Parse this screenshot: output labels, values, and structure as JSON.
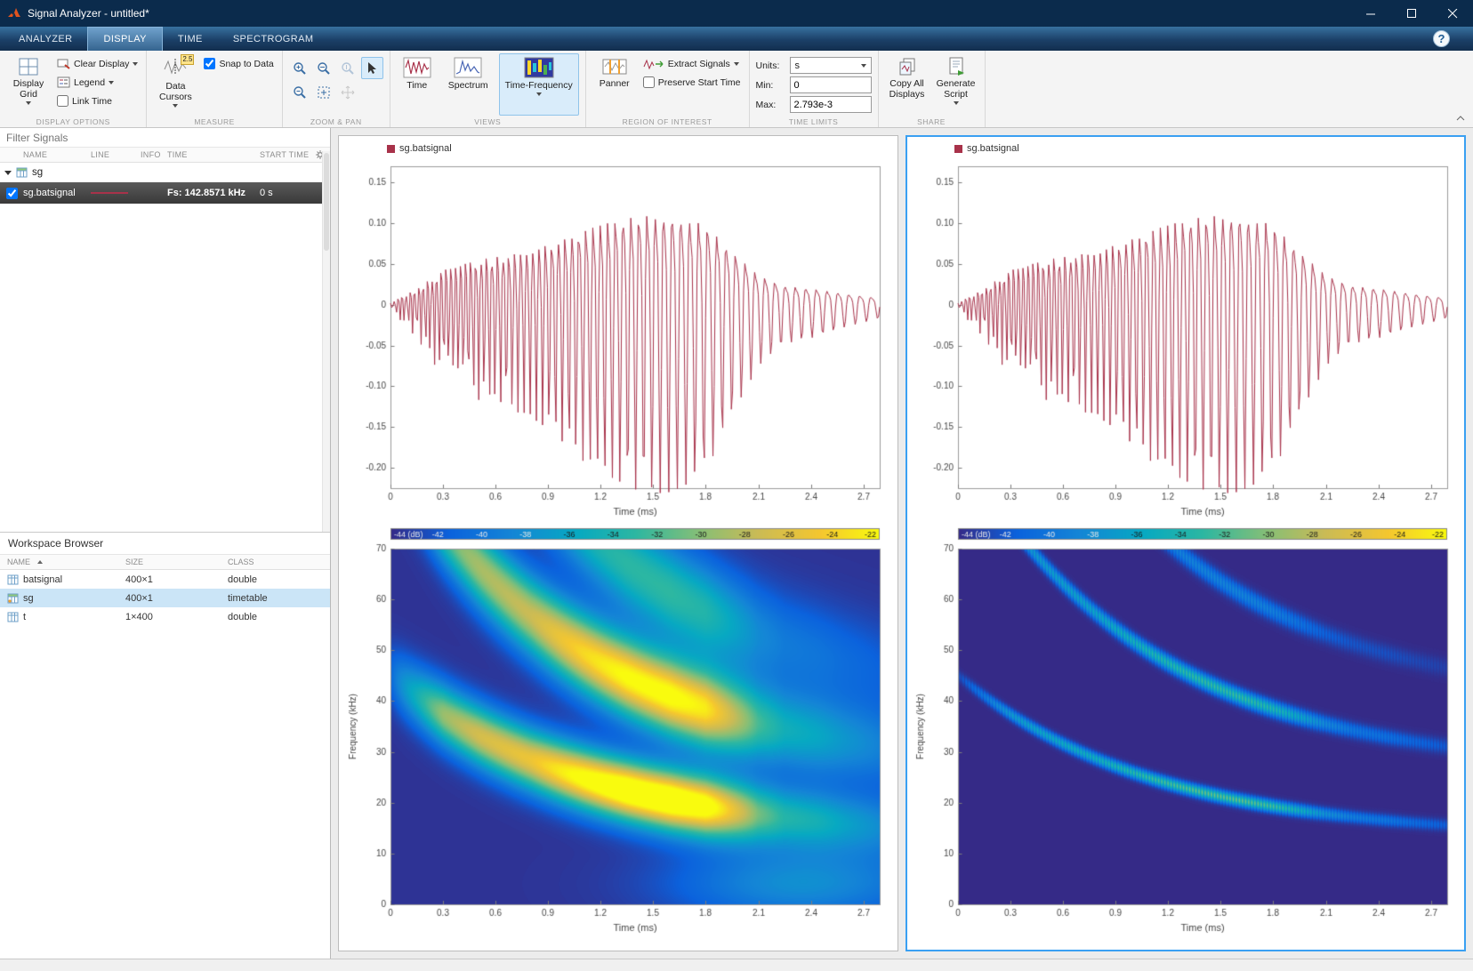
{
  "window": {
    "title": "Signal Analyzer - untitled*",
    "help": "?"
  },
  "tabs": [
    {
      "label": "ANALYZER"
    },
    {
      "label": "DISPLAY"
    },
    {
      "label": "TIME"
    },
    {
      "label": "SPECTROGRAM"
    }
  ],
  "ribbon": {
    "sections": {
      "display_options": {
        "label": "DISPLAY OPTIONS",
        "grid": "Display Grid",
        "clear": "Clear Display",
        "legend": "Legend",
        "link": "Link Time"
      },
      "measure": {
        "label": "MEASURE",
        "cursors": "Data Cursors",
        "badge": "2.5",
        "snap": "Snap to Data"
      },
      "zoom": {
        "label": "ZOOM & PAN"
      },
      "views": {
        "label": "VIEWS",
        "time": "Time",
        "spectrum": "Spectrum",
        "tf": "Time-Frequency"
      },
      "roi": {
        "label": "REGION OF INTEREST",
        "panner": "Panner",
        "extract": "Extract Signals",
        "preserve": "Preserve Start Time"
      },
      "limits": {
        "label": "TIME LIMITS",
        "units": "Units:",
        "units_value": "s",
        "min": "Min:",
        "min_value": "0",
        "max": "Max:",
        "max_value": "2.793e-3"
      },
      "share": {
        "label": "SHARE",
        "copy": "Copy All Displays",
        "script": "Generate Script"
      }
    }
  },
  "signals": {
    "filter_placeholder": "Filter Signals",
    "headers": {
      "name": "NAME",
      "line": "LINE",
      "info": "INFO",
      "time": "TIME",
      "start": "START TIME"
    },
    "group_label": "sg",
    "row": {
      "name": "sg.batsignal",
      "time": "Fs: 142.8571 kHz",
      "start": "0 s"
    }
  },
  "workspace": {
    "title": "Workspace Browser",
    "headers": {
      "name": "NAME",
      "size": "SIZE",
      "class": "CLASS"
    },
    "rows": [
      {
        "name": "batsignal",
        "size": "400×1",
        "class": "double"
      },
      {
        "name": "sg",
        "size": "400×1",
        "class": "timetable"
      },
      {
        "name": "t",
        "size": "1×400",
        "class": "double"
      }
    ]
  },
  "displays": [
    {
      "legend": "sg.batsignal",
      "selected": false,
      "spec": {
        "sigma": 4.2,
        "gain": 1.15,
        "floor": 0.02,
        "speckle": false,
        "patches": [
          {
            "t": 2.35,
            "f": 4,
            "st": 0.5,
            "sf": 5,
            "a": 0.26
          }
        ]
      }
    },
    {
      "legend": "sg.batsignal",
      "selected": true,
      "spec": {
        "sigma": 0.8,
        "gain": 0.62,
        "floor": 0.0,
        "speckle": true,
        "patches": []
      }
    }
  ],
  "chart_data": {
    "type": [
      "line",
      "heatmap"
    ],
    "time_plot": {
      "xlim": [
        0,
        2.793
      ],
      "ylim": [
        -0.225,
        0.17
      ],
      "x_ticks": [
        0,
        0.3,
        0.6,
        0.9,
        1.2,
        1.5,
        1.8,
        2.1,
        2.4,
        2.7
      ],
      "x_tick_labels": [
        "0",
        "0.3",
        "0.6",
        "0.9",
        "1.2",
        "1.5",
        "1.8",
        "2.1",
        "2.4",
        "2.7"
      ],
      "y_ticks": [
        0.15,
        0.1,
        0.05,
        0,
        -0.05,
        -0.1,
        -0.15,
        -0.2
      ],
      "y_tick_labels": [
        "0.15",
        "0.10",
        "0.05",
        "0",
        "-0.05",
        "-0.10",
        "-0.15",
        "-0.20"
      ],
      "xlabel": "Time (ms)",
      "line_color": "#a8324a"
    },
    "spectrogram": {
      "xlim": [
        0,
        2.793
      ],
      "ylim": [
        0,
        70
      ],
      "x_ticks": [
        0,
        0.3,
        0.6,
        0.9,
        1.2,
        1.5,
        1.8,
        2.1,
        2.4,
        2.7
      ],
      "x_tick_labels": [
        "0",
        "0.3",
        "0.6",
        "0.9",
        "1.2",
        "1.5",
        "1.8",
        "2.1",
        "2.4",
        "2.7"
      ],
      "y_ticks": [
        0,
        10,
        20,
        30,
        40,
        50,
        60,
        70
      ],
      "y_tick_labels": [
        "0",
        "10",
        "20",
        "30",
        "40",
        "50",
        "60",
        "70"
      ],
      "xlabel": "Time (ms)",
      "ylabel": "Frequency (kHz)",
      "colorbar_labels": [
        "-44 (dB)",
        "-42",
        "-40",
        "-38",
        "-36",
        "-34",
        "-32",
        "-30",
        "-28",
        "-26",
        "-24",
        "-22"
      ],
      "db_range": [
        -44,
        -22
      ]
    },
    "signal": {
      "n": 400,
      "fs_khz": 142.8571,
      "sweep": {
        "base": 13,
        "scale": 32,
        "tau_ms": 1.1
      },
      "env": [
        [
          0,
          0.004
        ],
        [
          0.15,
          0.03
        ],
        [
          0.3,
          0.065
        ],
        [
          0.5,
          0.085
        ],
        [
          0.8,
          0.1
        ],
        [
          1.1,
          0.14
        ],
        [
          1.35,
          0.165
        ],
        [
          1.6,
          0.17
        ],
        [
          1.8,
          0.15
        ],
        [
          1.95,
          0.1
        ],
        [
          2.1,
          0.055
        ],
        [
          2.25,
          0.035
        ],
        [
          2.45,
          0.028
        ],
        [
          2.6,
          0.02
        ],
        [
          2.8,
          0.012
        ]
      ],
      "harmonics": [
        [
          1,
          0.85
        ],
        [
          2,
          0.28
        ]
      ],
      "pos_scale": 0.92,
      "neg_scale": 1.22
    },
    "spec_model": {
      "harmonics": [
        [
          1,
          1.0
        ],
        [
          2,
          0.88
        ],
        [
          3,
          0.42
        ]
      ],
      "power": 0.6
    },
    "colormap": [
      [
        0,
        "#352a87"
      ],
      [
        0.12,
        "#0b62dd"
      ],
      [
        0.25,
        "#1486d6"
      ],
      [
        0.38,
        "#07a9c2"
      ],
      [
        0.5,
        "#2cb7a2"
      ],
      [
        0.63,
        "#85bf77"
      ],
      [
        0.75,
        "#cabb56"
      ],
      [
        0.88,
        "#f5c72f"
      ],
      [
        1,
        "#f9fb0e"
      ]
    ]
  }
}
